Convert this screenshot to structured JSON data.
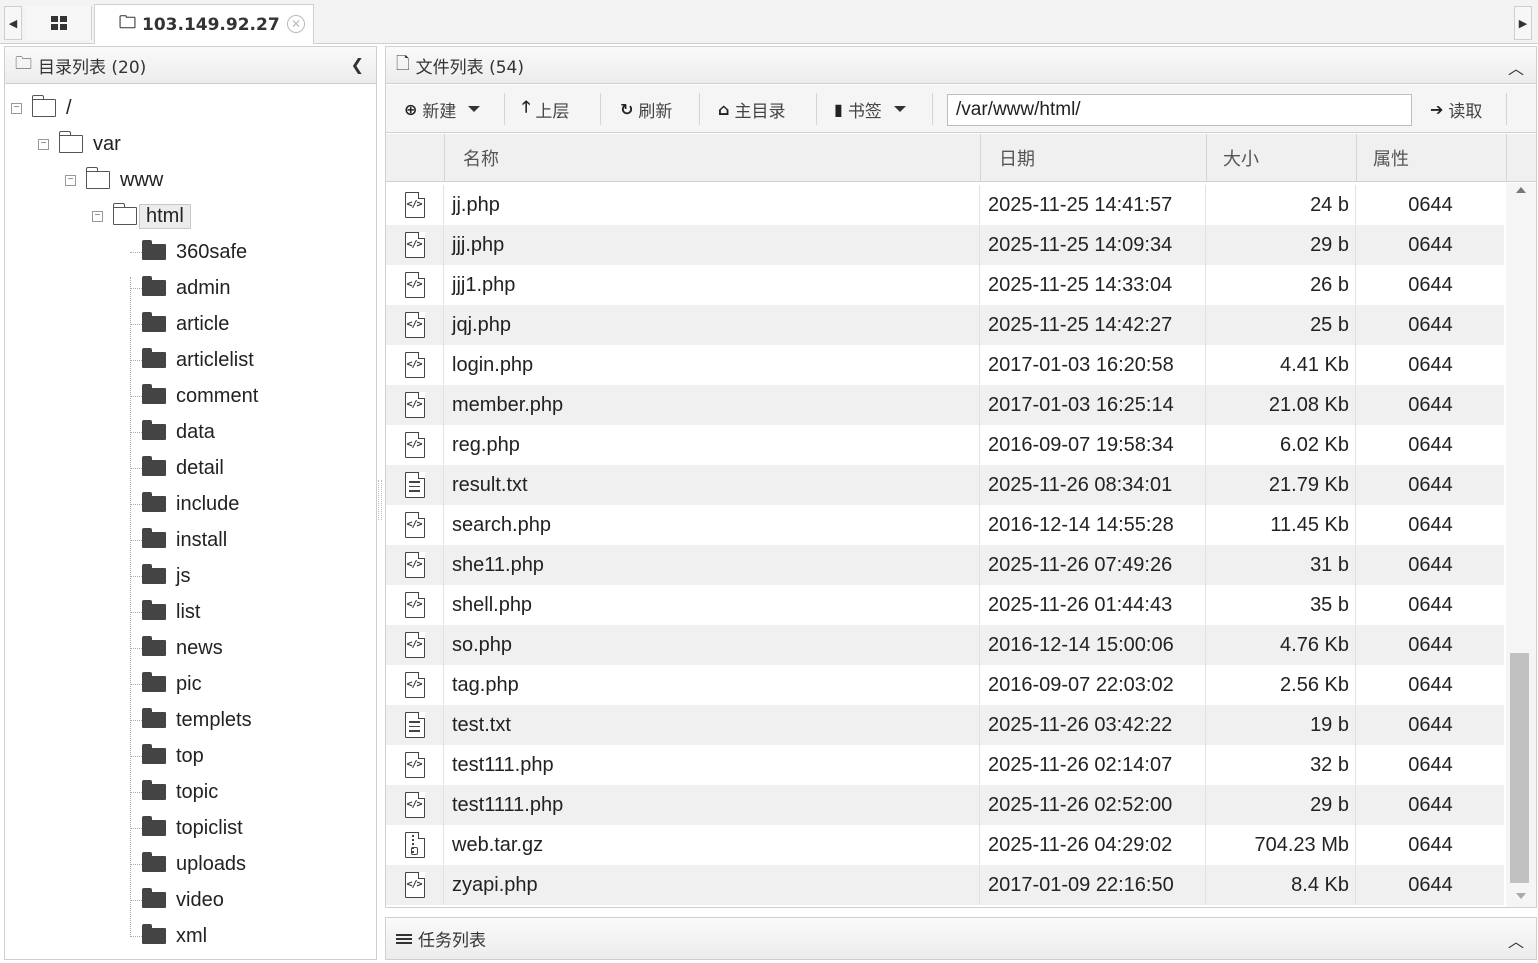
{
  "tabs": {
    "host": "103.149.92.27"
  },
  "left_panel": {
    "title": "目录列表 (20)",
    "tree": {
      "root": "/",
      "var": "var",
      "www": "www",
      "html": "html",
      "children": [
        "360safe",
        "admin",
        "article",
        "articlelist",
        "comment",
        "data",
        "detail",
        "include",
        "install",
        "js",
        "list",
        "news",
        "pic",
        "templets",
        "top",
        "topic",
        "topiclist",
        "uploads",
        "video",
        "xml"
      ]
    }
  },
  "right_panel": {
    "title": "文件列表 (54)",
    "toolbar": {
      "new_label": "新建",
      "up_label": "上层",
      "refresh_label": "刷新",
      "home_label": "主目录",
      "bookmark_label": "书签",
      "path_value": "/var/www/html/",
      "read_label": "读取"
    },
    "columns": {
      "name": "名称",
      "date": "日期",
      "size": "大小",
      "attr": "属性"
    },
    "files": [
      {
        "name": "jj.php",
        "date": "2025-11-25 14:41:57",
        "size": "24 b",
        "attr": "0644",
        "type": "code"
      },
      {
        "name": "jjj.php",
        "date": "2025-11-25 14:09:34",
        "size": "29 b",
        "attr": "0644",
        "type": "code"
      },
      {
        "name": "jjj1.php",
        "date": "2025-11-25 14:33:04",
        "size": "26 b",
        "attr": "0644",
        "type": "code"
      },
      {
        "name": "jqj.php",
        "date": "2025-11-25 14:42:27",
        "size": "25 b",
        "attr": "0644",
        "type": "code"
      },
      {
        "name": "login.php",
        "date": "2017-01-03 16:20:58",
        "size": "4.41 Kb",
        "attr": "0644",
        "type": "code"
      },
      {
        "name": "member.php",
        "date": "2017-01-03 16:25:14",
        "size": "21.08 Kb",
        "attr": "0644",
        "type": "code"
      },
      {
        "name": "reg.php",
        "date": "2016-09-07 19:58:34",
        "size": "6.02 Kb",
        "attr": "0644",
        "type": "code"
      },
      {
        "name": "result.txt",
        "date": "2025-11-26 08:34:01",
        "size": "21.79 Kb",
        "attr": "0644",
        "type": "text"
      },
      {
        "name": "search.php",
        "date": "2016-12-14 14:55:28",
        "size": "11.45 Kb",
        "attr": "0644",
        "type": "code"
      },
      {
        "name": "she11.php",
        "date": "2025-11-26 07:49:26",
        "size": "31 b",
        "attr": "0644",
        "type": "code"
      },
      {
        "name": "shell.php",
        "date": "2025-11-26 01:44:43",
        "size": "35 b",
        "attr": "0644",
        "type": "code"
      },
      {
        "name": "so.php",
        "date": "2016-12-14 15:00:06",
        "size": "4.76 Kb",
        "attr": "0644",
        "type": "code"
      },
      {
        "name": "tag.php",
        "date": "2016-09-07 22:03:02",
        "size": "2.56 Kb",
        "attr": "0644",
        "type": "code"
      },
      {
        "name": "test.txt",
        "date": "2025-11-26 03:42:22",
        "size": "19 b",
        "attr": "0644",
        "type": "text"
      },
      {
        "name": "test111.php",
        "date": "2025-11-26 02:14:07",
        "size": "32 b",
        "attr": "0644",
        "type": "code"
      },
      {
        "name": "test1111.php",
        "date": "2025-11-26 02:52:00",
        "size": "29 b",
        "attr": "0644",
        "type": "code"
      },
      {
        "name": "web.tar.gz",
        "date": "2025-11-26 04:29:02",
        "size": "704.23 Mb",
        "attr": "0644",
        "type": "archive"
      },
      {
        "name": "zyapi.php",
        "date": "2017-01-09 22:16:50",
        "size": "8.4 Kb",
        "attr": "0644",
        "type": "code"
      }
    ]
  },
  "task_panel": {
    "title": "任务列表"
  }
}
